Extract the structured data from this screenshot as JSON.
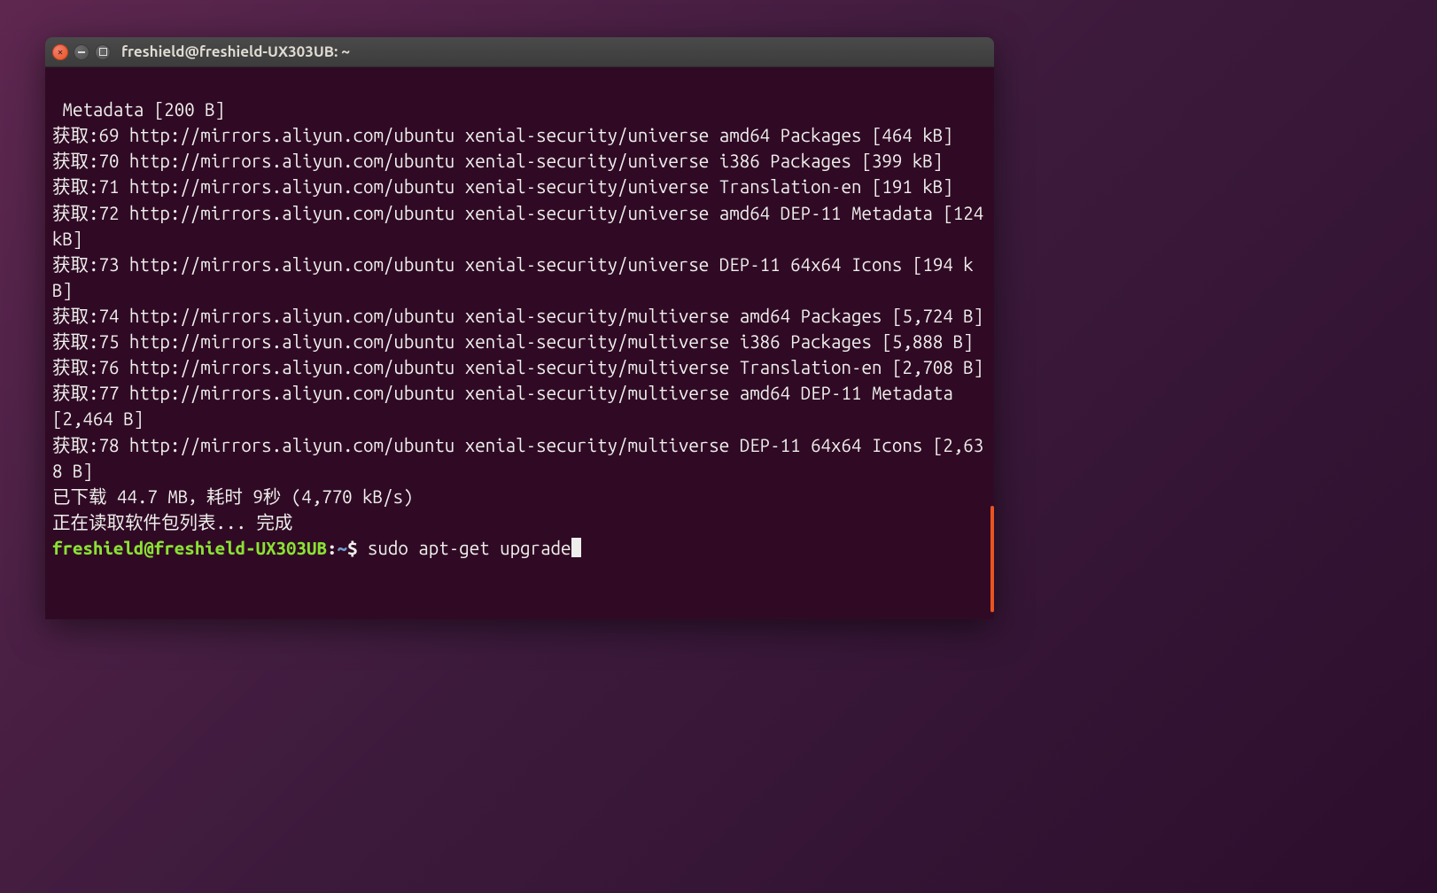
{
  "window": {
    "title": "freshield@freshield-UX303UB: ~"
  },
  "terminal": {
    "lines": [
      " Metadata [200 B]",
      "获取:69 http://mirrors.aliyun.com/ubuntu xenial-security/universe amd64 Packages [464 kB]",
      "获取:70 http://mirrors.aliyun.com/ubuntu xenial-security/universe i386 Packages [399 kB]",
      "获取:71 http://mirrors.aliyun.com/ubuntu xenial-security/universe Translation-en [191 kB]",
      "获取:72 http://mirrors.aliyun.com/ubuntu xenial-security/universe amd64 DEP-11 Metadata [124 kB]",
      "获取:73 http://mirrors.aliyun.com/ubuntu xenial-security/universe DEP-11 64x64 Icons [194 kB]",
      "获取:74 http://mirrors.aliyun.com/ubuntu xenial-security/multiverse amd64 Packages [5,724 B]",
      "获取:75 http://mirrors.aliyun.com/ubuntu xenial-security/multiverse i386 Packages [5,888 B]",
      "获取:76 http://mirrors.aliyun.com/ubuntu xenial-security/multiverse Translation-en [2,708 B]",
      "获取:77 http://mirrors.aliyun.com/ubuntu xenial-security/multiverse amd64 DEP-11 Metadata [2,464 B]",
      "获取:78 http://mirrors.aliyun.com/ubuntu xenial-security/multiverse DEP-11 64x64 Icons [2,638 B]",
      "已下载 44.7 MB，耗时 9秒 (4,770 kB/s)",
      "正在读取软件包列表... 完成"
    ],
    "prompt": {
      "user": "freshield@freshield-UX303UB",
      "separator": ":",
      "path": "~",
      "dollar": "$ ",
      "command": "sudo apt-get upgrade"
    }
  }
}
